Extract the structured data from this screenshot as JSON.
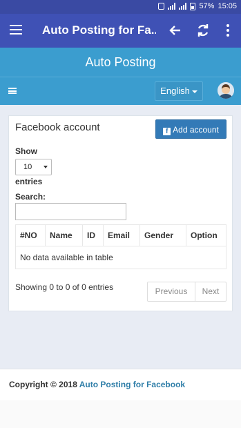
{
  "status_bar": {
    "battery": "57%",
    "time": "15:05"
  },
  "app_bar": {
    "title": "Auto Posting for Fa..."
  },
  "banner": {
    "title": "Auto Posting"
  },
  "navbar": {
    "language": "English"
  },
  "card": {
    "title": "Facebook account",
    "add_button": "Add account",
    "show_label": "Show",
    "entries_select": "10",
    "entries_label": "entries",
    "search_label": "Search:",
    "search_value": "",
    "table": {
      "columns": [
        "#NO",
        "Name",
        "ID",
        "Email",
        "Gender",
        "Option"
      ],
      "empty_message": "No data available in table"
    },
    "info": "Showing 0 to 0 of 0 entries",
    "pagination": {
      "previous": "Previous",
      "next": "Next"
    }
  },
  "footer": {
    "copyright": "Copyright © 2018",
    "link": "Auto Posting for Facebook"
  },
  "colors": {
    "app_bar": "#3f51b5",
    "banner": "#3b9dcf",
    "button": "#337ab7"
  }
}
